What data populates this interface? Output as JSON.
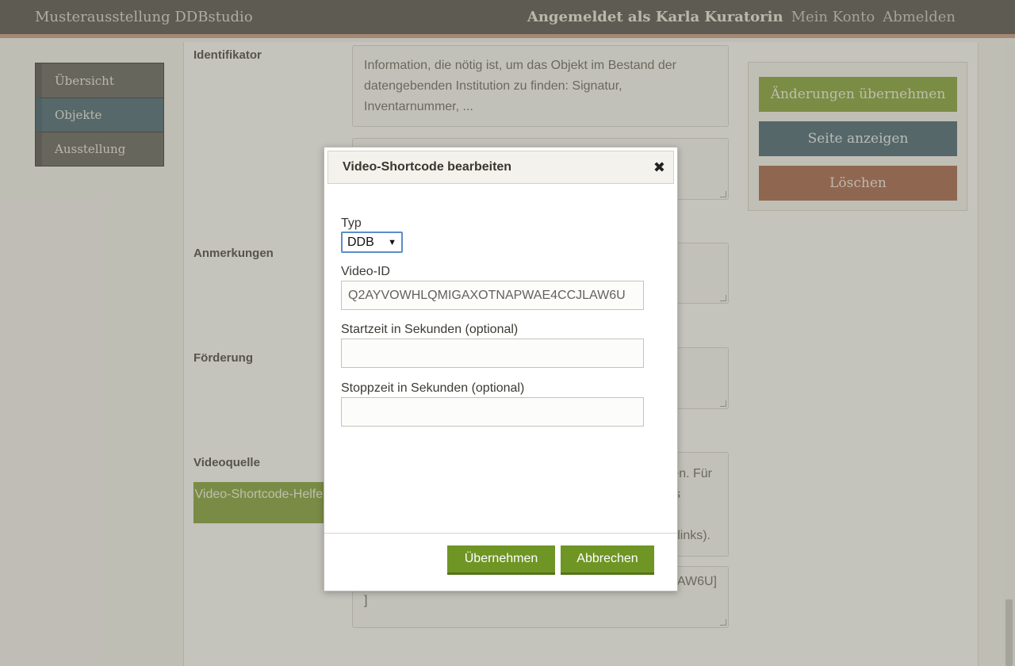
{
  "topbar": {
    "brand": "Musterausstellung DDBstudio",
    "user": "Angemeldet als Karla Kuratorin",
    "account": "Mein Konto",
    "logout": "Abmelden"
  },
  "sidebar": {
    "items": [
      {
        "label": "Übersicht"
      },
      {
        "label": "Objekte"
      },
      {
        "label": "Ausstellung"
      }
    ]
  },
  "form": {
    "identifikator_label": "Identifikator",
    "identifikator_help": "Information, die nötig ist, um das Objekt im Bestand der datengebenden Institution zu finden: Signatur, Inventarnummer, ...",
    "anmerkungen_label": "Anmerkungen",
    "foerderung_label": "Förderung",
    "videoquelle_label": "Videoquelle",
    "helper_button": "Video-Shortcode-Helfer",
    "videoquelle_help_fragment_1": "en. Für",
    "videoquelle_help_fragment_2": "s",
    "videoquelle_help_fragment_3": "links).",
    "videoquelle_value_fragment": "AW6U]\n]"
  },
  "actions": {
    "apply": "Änderungen übernehmen",
    "view": "Seite anzeigen",
    "delete": "Löschen"
  },
  "dialog": {
    "title": "Video-Shortcode bearbeiten",
    "type_label": "Typ",
    "type_value": "DDB",
    "video_id_label": "Video-ID",
    "video_id_value": "Q2AYVOWHLQMIGAXOTNAPWAE4CCJLAW6U",
    "start_label": "Startzeit in Sekunden (optional)",
    "start_value": "",
    "stop_label": "Stoppzeit in Sekunden (optional)",
    "stop_value": "",
    "ok": "Übernehmen",
    "cancel": "Abbrechen"
  },
  "colors": {
    "topbar": "#4b4840",
    "accent_green": "#7e9b2a",
    "accent_teal": "#3e5c68",
    "accent_rust": "#a05c3f"
  }
}
